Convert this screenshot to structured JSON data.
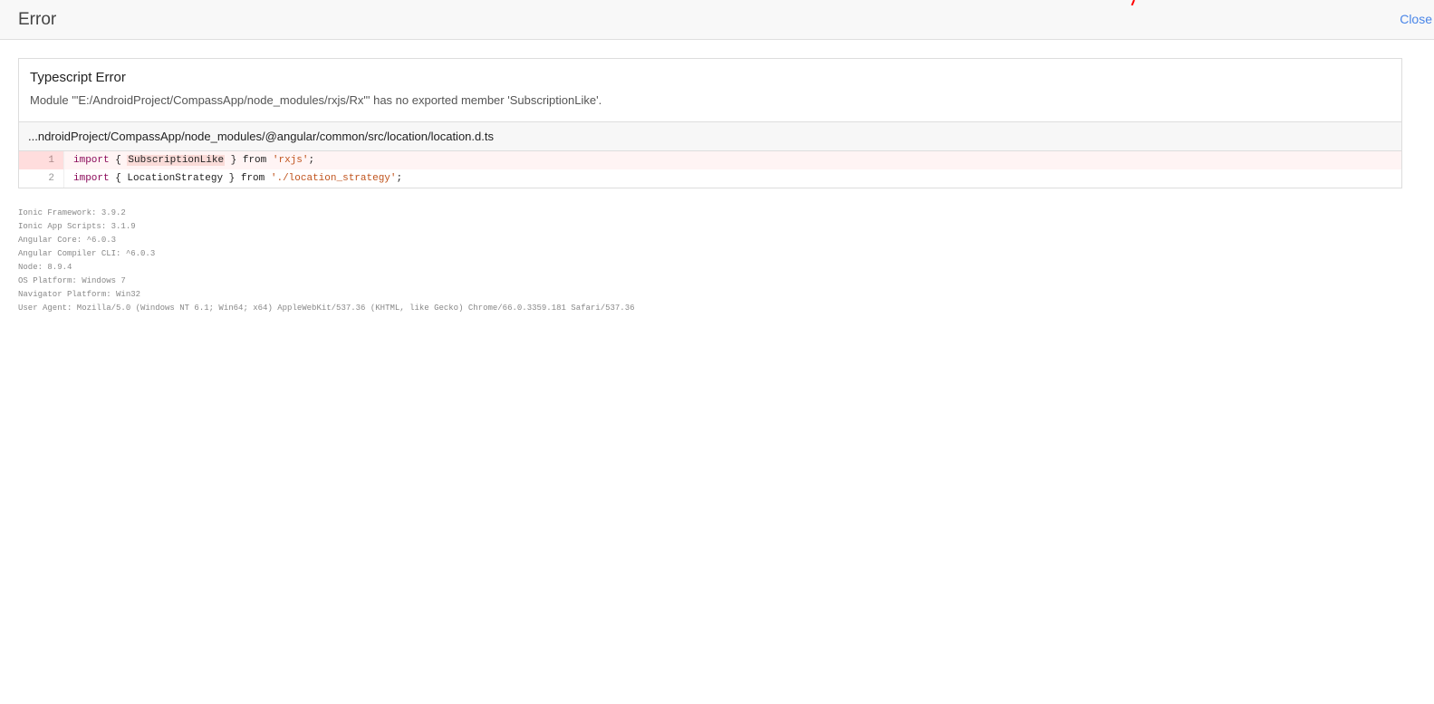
{
  "header": {
    "title": "Error",
    "close_label": "Close"
  },
  "error": {
    "type": "Typescript Error",
    "message": "Module '\"E:/AndroidProject/CompassApp/node_modules/rxjs/Rx\"' has no exported member 'SubscriptionLike'.",
    "file": "...ndroidProject/CompassApp/node_modules/@angular/common/src/location/location.d.ts"
  },
  "code_lines": [
    {
      "number": "1",
      "kw1": "import",
      "open": " { ",
      "token": "SubscriptionLike",
      "close": " } ",
      "kw2": "from",
      "space": " ",
      "str": "'rxjs'",
      "end": ";"
    },
    {
      "number": "2",
      "kw1": "import",
      "open": " { ",
      "token": "LocationStrategy",
      "close": " } ",
      "kw2": "from",
      "space": " ",
      "str": "'./location_strategy'",
      "end": ";"
    }
  ],
  "system_info": [
    "Ionic Framework: 3.9.2",
    "Ionic App Scripts: 3.1.9",
    "Angular Core: ^6.0.3",
    "Angular Compiler CLI: ^6.0.3",
    "Node: 8.9.4",
    "OS Platform: Windows 7",
    "Navigator Platform: Win32",
    "User Agent: Mozilla/5.0 (Windows NT 6.1; Win64; x64) AppleWebKit/537.36 (KHTML, like Gecko) Chrome/66.0.3359.181 Safari/537.36"
  ],
  "colors": {
    "accent_link": "#4a86e8",
    "highlight_line": "#fff4f4",
    "highlight_gutter": "#ffdddd",
    "keyword": "#8b0a5a",
    "string": "#c0531c",
    "red_mark": "#ff0000"
  }
}
